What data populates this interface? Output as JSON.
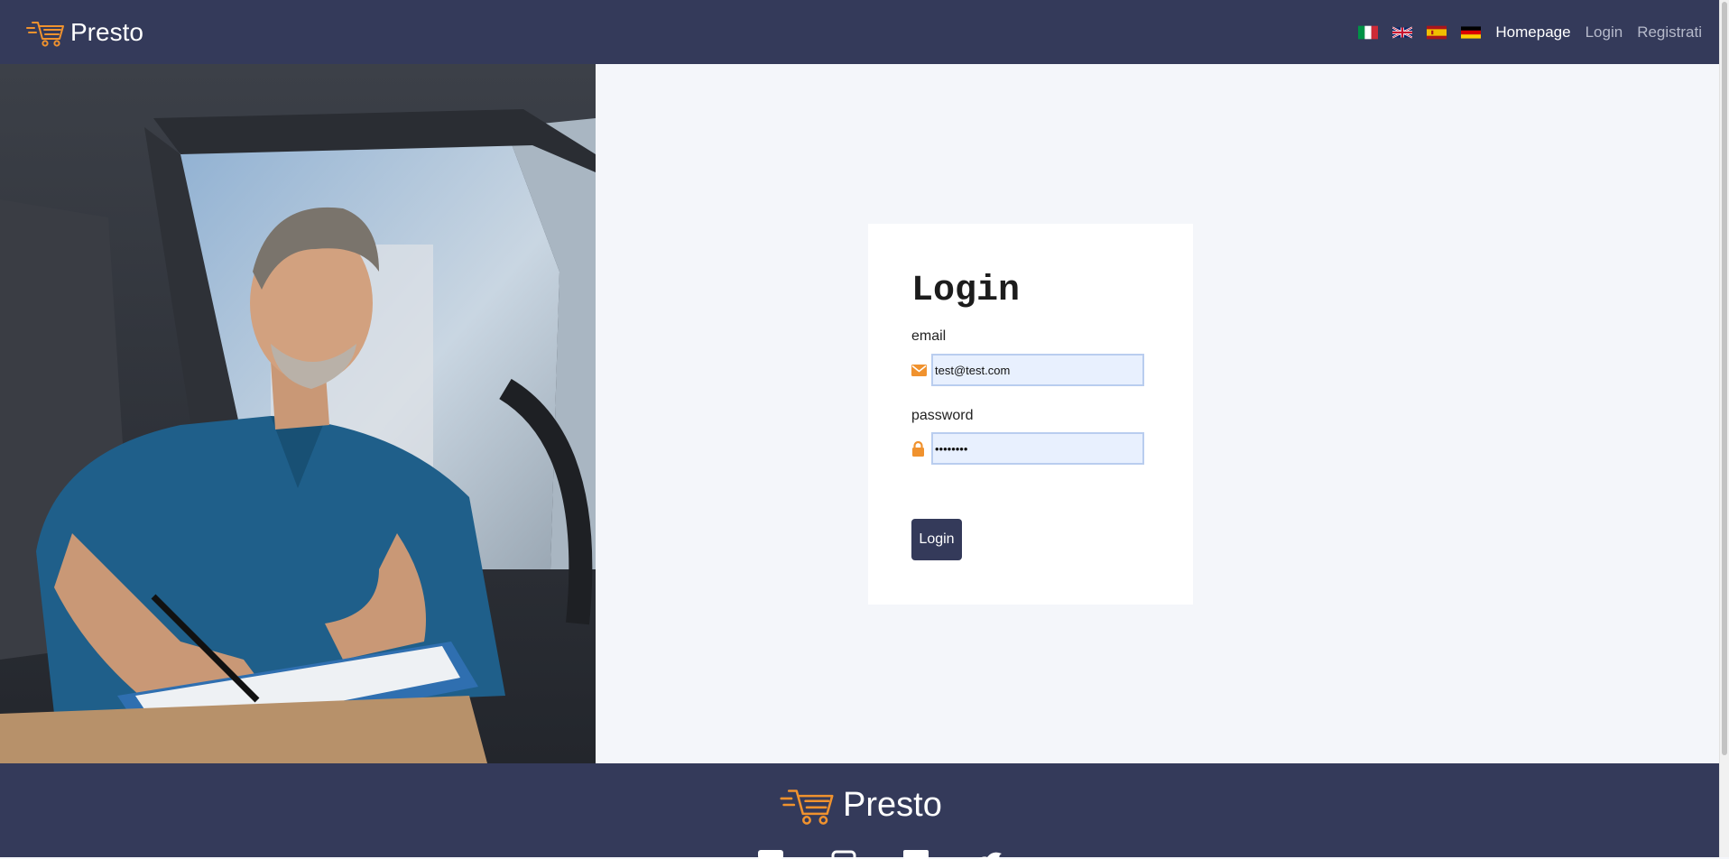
{
  "navbar": {
    "brand": "Presto",
    "flags": [
      "italian-flag-icon",
      "uk-flag-icon",
      "spanish-flag-icon",
      "german-flag-icon"
    ],
    "links": [
      "Homepage",
      "Login",
      "Registrati"
    ]
  },
  "login_card": {
    "title": "Login",
    "email_label": "email",
    "email_value": "test@test.com",
    "password_label": "password",
    "password_value": "password",
    "submit_label": "Login"
  },
  "footer": {
    "brand": "Presto",
    "social_icons": [
      "facebook-icon",
      "instagram-icon",
      "linkedin-icon",
      "twitter-icon"
    ]
  },
  "colors": {
    "navbar_bg": "#343a5a",
    "accent_orange": "#f0922e",
    "page_bg": "#f4f6fa",
    "input_bg": "#e8f0fe"
  }
}
